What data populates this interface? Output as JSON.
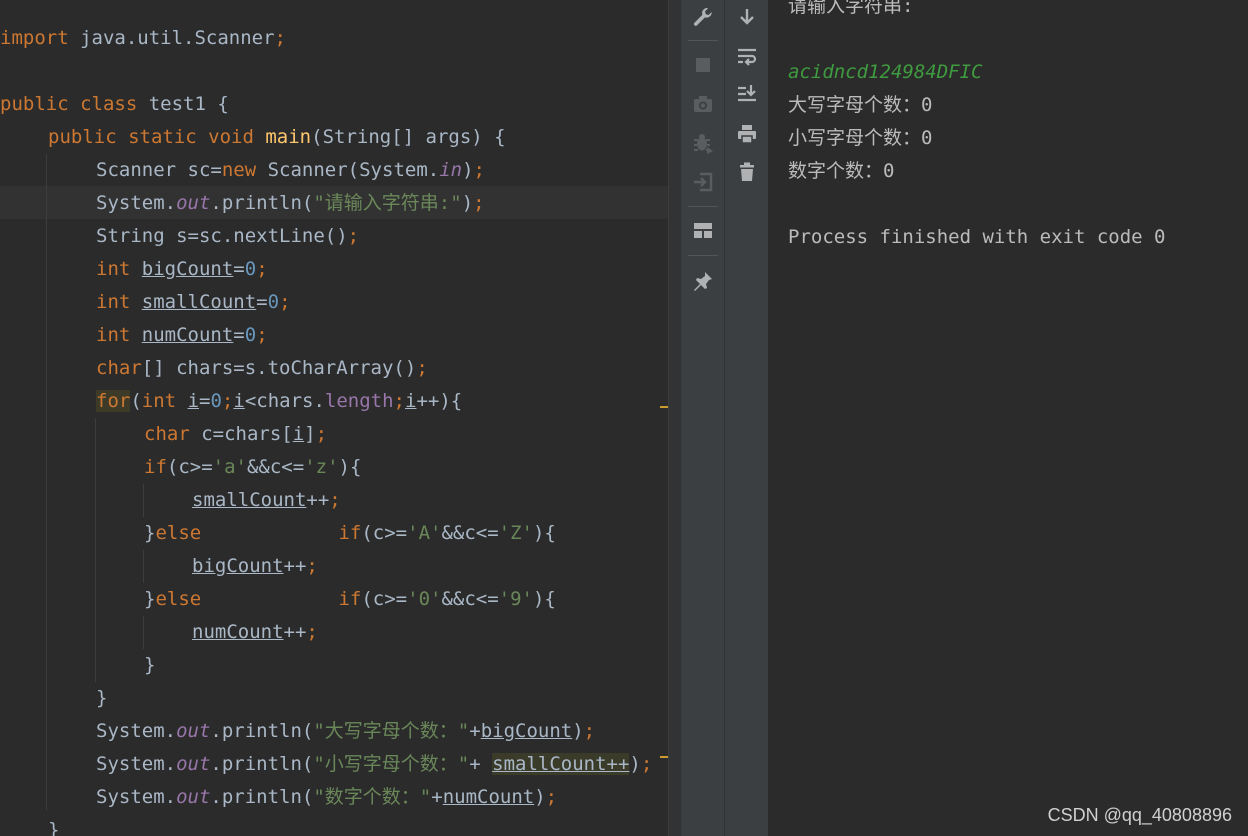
{
  "editor": {
    "lines": [
      {
        "t": [
          "import java.util.Scanner;"
        ]
      },
      {
        "t": []
      },
      {
        "t": [
          "public class test1 {"
        ]
      },
      {
        "t": [
          "public static void main(String[] args) {"
        ]
      },
      {
        "t": [
          "Scanner sc=new Scanner(System.in);"
        ]
      },
      {
        "t": [
          "System.out.println(\"请输入字符串:\");"
        ]
      },
      {
        "t": [
          "String s=sc.nextLine();"
        ]
      },
      {
        "t": [
          "int bigCount=0;"
        ]
      },
      {
        "t": [
          "int smallCount=0;"
        ]
      },
      {
        "t": [
          "int numCount=0;"
        ]
      },
      {
        "t": [
          "char[] chars=s.toCharArray();"
        ]
      },
      {
        "t": [
          "for(int i=0;i<chars.length;i++){"
        ]
      },
      {
        "t": [
          "char c=chars[i];"
        ]
      },
      {
        "t": [
          "if(c>='a'&&c<='z'){"
        ]
      },
      {
        "t": [
          "smallCount++;"
        ]
      },
      {
        "t": [
          "}else            if(c>='A'&&c<='Z'){"
        ]
      },
      {
        "t": [
          "bigCount++;"
        ]
      },
      {
        "t": [
          "}else            if(c>='0'&&c<='9'){"
        ]
      },
      {
        "t": [
          "numCount++;"
        ]
      },
      {
        "t": [
          "}"
        ]
      },
      {
        "t": [
          "}"
        ]
      },
      {
        "t": [
          "System.out.println(\"大写字母个数：\"+bigCount);"
        ]
      },
      {
        "t": [
          "System.out.println(\"小写字母个数：\"+ smallCount++);"
        ]
      },
      {
        "t": [
          "System.out.println(\"数字个数：\"+numCount);"
        ]
      },
      {
        "t": [
          "}"
        ]
      }
    ]
  },
  "toolbar_left": {
    "icons": [
      "wrench-icon",
      "stop-icon",
      "camera-icon",
      "debug-bug-icon",
      "login-exit-icon",
      "layout-icon",
      "pin-icon"
    ]
  },
  "toolbar_right": {
    "icons": [
      "arrow-down-icon",
      "soft-wrap-icon",
      "scroll-to-end-icon",
      "print-icon",
      "trash-icon"
    ]
  },
  "console": {
    "prompt": "请输入字符串:",
    "input": "acidncd124984DFIC",
    "upper_line": "大写字母个数：0",
    "lower_line": "小写字母个数：0",
    "digit_line": "数字个数：0",
    "exit_line": "Process finished with exit code 0"
  },
  "watermark": "CSDN @qq_40808896",
  "colors": {
    "background": "#2b2b2b",
    "keyword": "#cc7832",
    "string": "#6a8759",
    "number": "#6897bb",
    "field": "#9876aa",
    "method_decl": "#ffc66d",
    "console_input": "#3f9b3f",
    "default_text": "#a9b7c6"
  }
}
